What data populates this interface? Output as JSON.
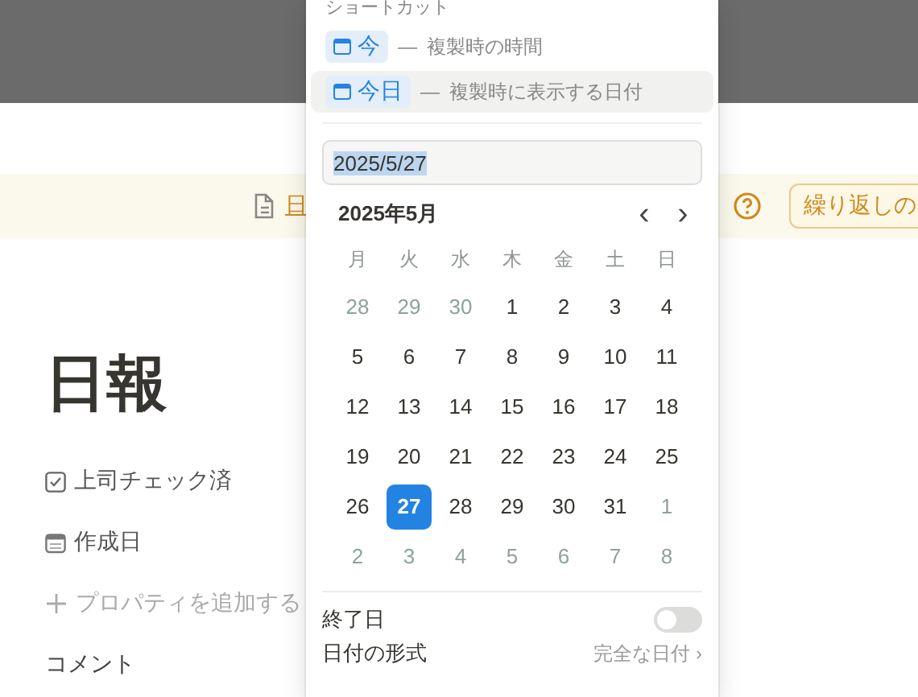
{
  "banner": {
    "link": "日",
    "button": "繰り返しの"
  },
  "page": {
    "title": "日報",
    "properties": [
      {
        "kind": "checkbox",
        "label": "上司チェック済"
      },
      {
        "kind": "date",
        "label": "作成日"
      },
      {
        "kind": "add",
        "label": "プロパティを追加する"
      }
    ],
    "comment_label": "コメント"
  },
  "popup": {
    "heading": "ショートカット",
    "shortcuts": [
      {
        "chip": "今",
        "description": "複製時の時間",
        "selected": false
      },
      {
        "chip": "今日",
        "description": "複製時に表示する日付",
        "selected": true
      }
    ],
    "dash": "—",
    "date_value": "2025/5/27",
    "month": "2025年5月",
    "prev": "‹",
    "next": "›",
    "weekdays": [
      "月",
      "火",
      "水",
      "木",
      "金",
      "土",
      "日"
    ],
    "weeks": [
      [
        {
          "d": "28",
          "muted": true,
          "selected": false
        },
        {
          "d": "29",
          "muted": true,
          "selected": false
        },
        {
          "d": "30",
          "muted": true,
          "selected": false
        },
        {
          "d": "1",
          "muted": false,
          "selected": false
        },
        {
          "d": "2",
          "muted": false,
          "selected": false
        },
        {
          "d": "3",
          "muted": false,
          "selected": false
        },
        {
          "d": "4",
          "muted": false,
          "selected": false
        }
      ],
      [
        {
          "d": "5",
          "muted": false,
          "selected": false
        },
        {
          "d": "6",
          "muted": false,
          "selected": false
        },
        {
          "d": "7",
          "muted": false,
          "selected": false
        },
        {
          "d": "8",
          "muted": false,
          "selected": false
        },
        {
          "d": "9",
          "muted": false,
          "selected": false
        },
        {
          "d": "10",
          "muted": false,
          "selected": false
        },
        {
          "d": "11",
          "muted": false,
          "selected": false
        }
      ],
      [
        {
          "d": "12",
          "muted": false,
          "selected": false
        },
        {
          "d": "13",
          "muted": false,
          "selected": false
        },
        {
          "d": "14",
          "muted": false,
          "selected": false
        },
        {
          "d": "15",
          "muted": false,
          "selected": false
        },
        {
          "d": "16",
          "muted": false,
          "selected": false
        },
        {
          "d": "17",
          "muted": false,
          "selected": false
        },
        {
          "d": "18",
          "muted": false,
          "selected": false
        }
      ],
      [
        {
          "d": "19",
          "muted": false,
          "selected": false
        },
        {
          "d": "20",
          "muted": false,
          "selected": false
        },
        {
          "d": "21",
          "muted": false,
          "selected": false
        },
        {
          "d": "22",
          "muted": false,
          "selected": false
        },
        {
          "d": "23",
          "muted": false,
          "selected": false
        },
        {
          "d": "24",
          "muted": false,
          "selected": false
        },
        {
          "d": "25",
          "muted": false,
          "selected": false
        }
      ],
      [
        {
          "d": "26",
          "muted": false,
          "selected": false
        },
        {
          "d": "27",
          "muted": false,
          "selected": true
        },
        {
          "d": "28",
          "muted": false,
          "selected": false
        },
        {
          "d": "29",
          "muted": false,
          "selected": false
        },
        {
          "d": "30",
          "muted": false,
          "selected": false
        },
        {
          "d": "31",
          "muted": false,
          "selected": false
        },
        {
          "d": "1",
          "muted": true,
          "selected": false
        }
      ],
      [
        {
          "d": "2",
          "muted": true,
          "selected": false
        },
        {
          "d": "3",
          "muted": true,
          "selected": false
        },
        {
          "d": "4",
          "muted": true,
          "selected": false
        },
        {
          "d": "5",
          "muted": true,
          "selected": false
        },
        {
          "d": "6",
          "muted": true,
          "selected": false
        },
        {
          "d": "7",
          "muted": true,
          "selected": false
        },
        {
          "d": "8",
          "muted": true,
          "selected": false
        }
      ]
    ],
    "end_date": {
      "label": "終了日",
      "on": false
    },
    "format": {
      "label": "日付の形式",
      "value": "完全な日付",
      "chevron": "›"
    }
  }
}
